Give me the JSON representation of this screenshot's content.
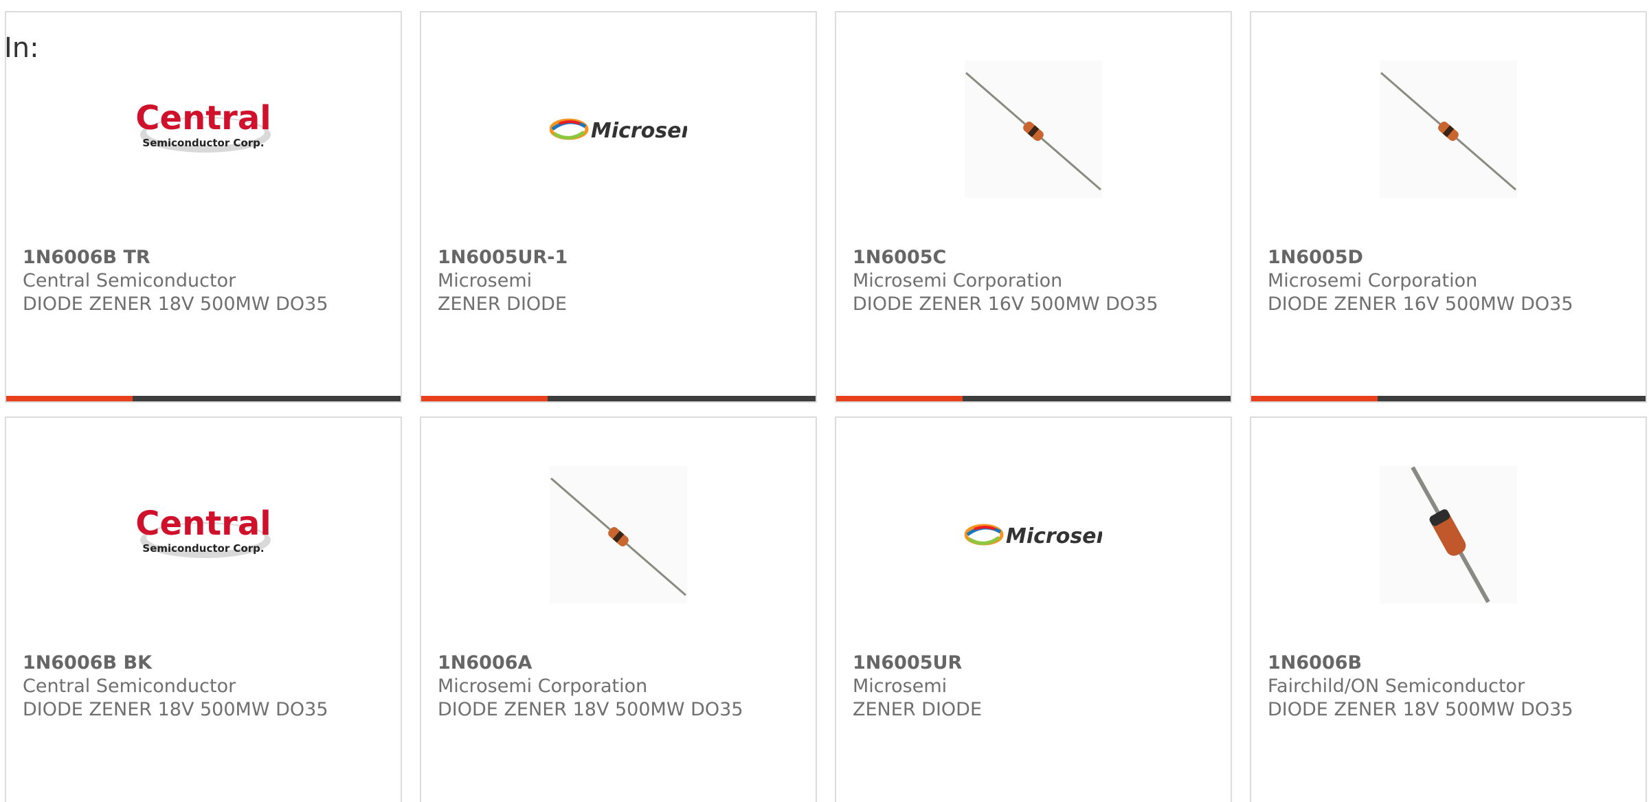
{
  "page": {
    "prefix_label": "In:"
  },
  "theme": {
    "accent": "#e8401c",
    "bar_dark": "#3d3d3d",
    "border": "#dcdcdc",
    "text": "#6f6f6f"
  },
  "logos": {
    "central_main": "Central",
    "central_sub": "Semiconductor Corp.",
    "microsemi": "Microsemi"
  },
  "products": [
    {
      "part_number": "1N6006B TR",
      "manufacturer": "Central Semiconductor",
      "description": "DIODE ZENER 18V 500MW DO35",
      "image_icon": "central-semiconductor-logo",
      "progress": 0.32
    },
    {
      "part_number": "1N6005UR-1",
      "manufacturer": "Microsemi",
      "description": "ZENER DIODE",
      "image_icon": "microsemi-logo",
      "progress": 0.32
    },
    {
      "part_number": "1N6005C",
      "manufacturer": "Microsemi Corporation",
      "description": "DIODE ZENER 16V 500MW DO35",
      "image_icon": "axial-diode-photo",
      "progress": 0.32
    },
    {
      "part_number": "1N6005D",
      "manufacturer": "Microsemi Corporation",
      "description": "DIODE ZENER 16V 500MW DO35",
      "image_icon": "axial-diode-photo",
      "progress": 0.32
    },
    {
      "part_number": "1N6006B BK",
      "manufacturer": "Central Semiconductor",
      "description": "DIODE ZENER 18V 500MW DO35",
      "image_icon": "central-semiconductor-logo"
    },
    {
      "part_number": "1N6006A",
      "manufacturer": "Microsemi Corporation",
      "description": "DIODE ZENER 18V 500MW DO35",
      "image_icon": "axial-diode-photo"
    },
    {
      "part_number": "1N6005UR",
      "manufacturer": "Microsemi",
      "description": "ZENER DIODE",
      "image_icon": "microsemi-logo"
    },
    {
      "part_number": "1N6006B",
      "manufacturer": "Fairchild/ON Semiconductor",
      "description": "DIODE ZENER 18V 500MW DO35",
      "image_icon": "axial-diode-closeup-photo"
    }
  ]
}
